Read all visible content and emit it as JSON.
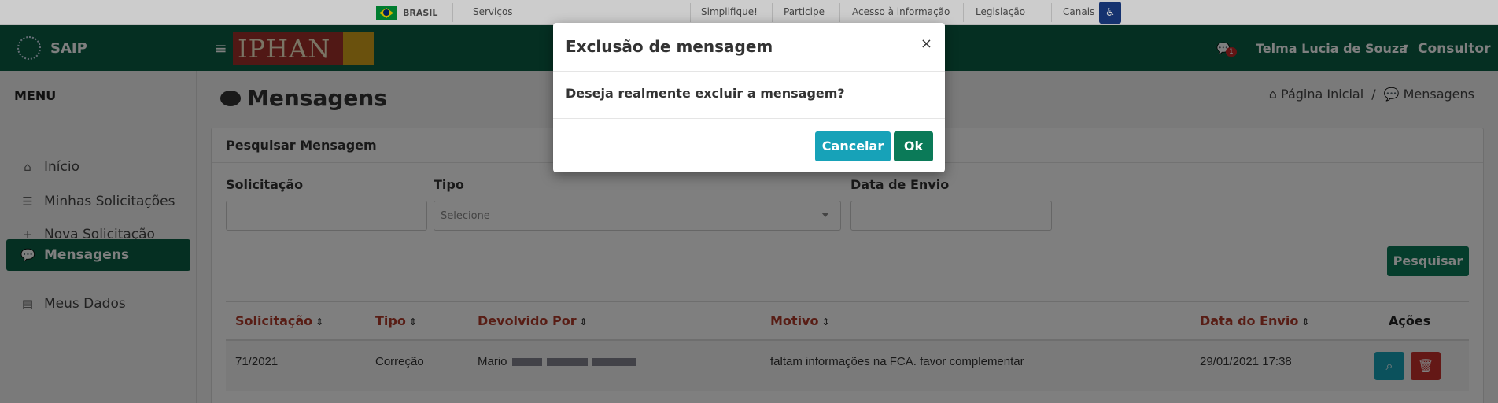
{
  "gov_bar": {
    "country": "BRASIL",
    "links": [
      "Serviços",
      "Simplifique!",
      "Participe",
      "Acesso à informação",
      "Legislação",
      "Canais"
    ]
  },
  "sidebar": {
    "app_name": "SAIP",
    "menu_title": "MENU",
    "items": [
      {
        "label": "Início",
        "icon": "home-icon"
      },
      {
        "label": "Minhas Solicitações",
        "icon": "list-icon"
      },
      {
        "label": "Nova Solicitação",
        "icon": "plus-icon"
      },
      {
        "label": "Mensagens",
        "icon": "comments-icon",
        "active": true
      },
      {
        "label": "Meus Dados",
        "icon": "file-icon"
      }
    ]
  },
  "header": {
    "logo_text": "IPHAN",
    "notification_count": "1",
    "user_name": "Telma Lucia de Souza",
    "user_role": "Consultor"
  },
  "page": {
    "title": "Mensagens",
    "breadcrumb": [
      "Página Inicial",
      "/",
      "Mensagens"
    ]
  },
  "search": {
    "card_title": "Pesquisar Mensagem",
    "field_solicitacao": "Solicitação",
    "field_tipo": "Tipo",
    "field_tipo_placeholder": "Selecione",
    "field_data": "Data de Envio",
    "button": "Pesquisar"
  },
  "table": {
    "columns": [
      "Solicitação",
      "Tipo",
      "Devolvido Por",
      "Motivo",
      "Data do Envio",
      "Ações"
    ],
    "rows": [
      {
        "solicitacao": "71/2021",
        "tipo": "Correção",
        "devolvido_por": "Mario",
        "motivo": "faltam informações na FCA. favor complementar",
        "data": "29/01/2021 17:38"
      }
    ]
  },
  "modal": {
    "title": "Exclusão de mensagem",
    "close": "×",
    "body": "Deseja realmente excluir a mensagem?",
    "cancel": "Cancelar",
    "ok": "Ok"
  },
  "colors": {
    "primary_green": "#0b5e45",
    "header_red": "#b13a2a",
    "info_blue": "#17a2b8",
    "danger_red": "#c9302c"
  }
}
